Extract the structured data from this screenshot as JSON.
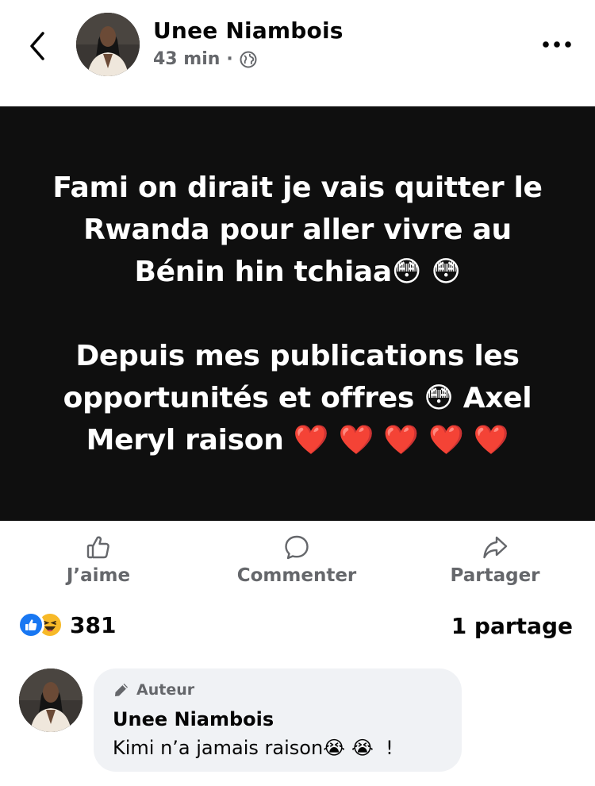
{
  "header": {
    "back_icon": "chevron-left-icon",
    "author": "Unee Niambois",
    "time": "43 min",
    "separator": "·",
    "privacy_icon": "globe-icon",
    "more_icon": "more-horizontal-icon"
  },
  "post": {
    "text": "Fami on dirait je vais quitter le\nRwanda pour aller vivre au\nBénin hin tchiaa😳 😳\n\nDepuis mes publications les\nopportunités et offres 😳 Axel\nMeryl raison ❤️ ❤️ ❤️ ❤️ ❤️",
    "background": "#0f0f0f"
  },
  "actions": {
    "like": "J’aime",
    "comment": "Commenter",
    "share": "Partager"
  },
  "stats": {
    "reactions_icons": [
      "like-icon",
      "haha-icon"
    ],
    "reaction_count": "381",
    "shares": "1 partage"
  },
  "comment": {
    "badge": "Auteur",
    "author": "Unee Niambois",
    "text": "Kimi n’a jamais raison😭 😭  !"
  },
  "colors": {
    "accent": "#1877f2",
    "muted": "#65676b",
    "bubble": "#f0f2f5",
    "haha": "#f7b928"
  }
}
